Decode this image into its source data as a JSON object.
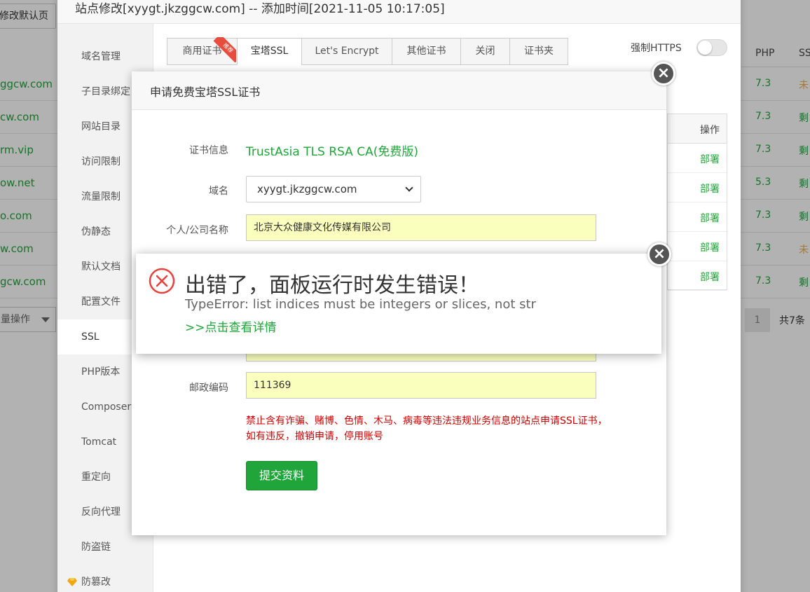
{
  "background": {
    "set_default_button": "修改默认页",
    "columns": {
      "php": "PHP",
      "ssl": "SS"
    },
    "rows": [
      {
        "domain": "ggcw.com",
        "php": "7.3",
        "ssl": "未",
        "ssl_color": "#f0ad4e"
      },
      {
        "domain": "cw.com",
        "php": "7.3",
        "ssl": "剩",
        "ssl_color": "#20a53a"
      },
      {
        "domain": "rm.vip",
        "php": "7.3",
        "ssl": "剩",
        "ssl_color": "#20a53a"
      },
      {
        "domain": "ow.net",
        "php": "5.3",
        "ssl": "剩",
        "ssl_color": "#20a53a"
      },
      {
        "domain": "o.com",
        "php": "7.3",
        "ssl": "剩",
        "ssl_color": "#20a53a"
      },
      {
        "domain": "w.com",
        "php": "7.3",
        "ssl": "未",
        "ssl_color": "#f0ad4e"
      },
      {
        "domain": "gcw.com",
        "php": "7.3",
        "ssl": "剩",
        "ssl_color": "#20a53a"
      }
    ],
    "batch_select": "量操作",
    "pager": {
      "current": "1",
      "total": "共7条"
    }
  },
  "site_edit": {
    "title": "站点修改[xyygt.jkzggcw.com] -- 添加时间[2021-11-05 10:17:05]",
    "menu": [
      {
        "label": "域名管理"
      },
      {
        "label": "子目录绑定"
      },
      {
        "label": "网站目录"
      },
      {
        "label": "访问限制"
      },
      {
        "label": "流量限制"
      },
      {
        "label": "伪静态"
      },
      {
        "label": "默认文档"
      },
      {
        "label": "配置文件"
      },
      {
        "label": "SSL"
      },
      {
        "label": "PHP版本"
      },
      {
        "label": "Composer"
      },
      {
        "label": "Tomcat"
      },
      {
        "label": "重定向"
      },
      {
        "label": "反向代理"
      },
      {
        "label": "防盗链"
      },
      {
        "label": "防篡改"
      }
    ],
    "active_menu": "SSL",
    "tabs": [
      {
        "label": "商用证书"
      },
      {
        "label": "宝塔SSL"
      },
      {
        "label": "Let's Encrypt"
      },
      {
        "label": "其他证书"
      },
      {
        "label": "关闭"
      },
      {
        "label": "证书夹"
      }
    ],
    "ribbon_label": "推荐",
    "force_https_label": "强制HTTPS",
    "force_https_on": false,
    "table": {
      "action_header": "操作",
      "actions": [
        "部署",
        "部署",
        "部署",
        "部署",
        "部署"
      ]
    }
  },
  "ssl_dialog": {
    "title": "申请免费宝塔SSL证书",
    "cert_info_label": "证书信息",
    "cert_info_value": "TrustAsia TLS RSA CA(免费版)",
    "domain_label": "域名",
    "domain_value": "xyygt.jkzggcw.com",
    "company_label": "个人/公司名称",
    "company_value": "北京大众健康文化传媒有限公司",
    "postcode_label": "邮政编码",
    "postcode_value": "111369",
    "warning_line1": "禁止含有诈骗、赌博、色情、木马、病毒等违法违规业务信息的站点申请SSL证书，",
    "warning_line2": "如有违反，撤销申请，停用账号",
    "submit_label": "提交资料"
  },
  "error_popup": {
    "title": "出错了，面板运行时发生错误！",
    "detail": "TypeError: list indices must be integers or slices, not str",
    "link": ">>点击查看详情"
  },
  "colors": {
    "accent": "#20a53a",
    "error": "#e8413b",
    "warning_text": "#cc0000"
  }
}
